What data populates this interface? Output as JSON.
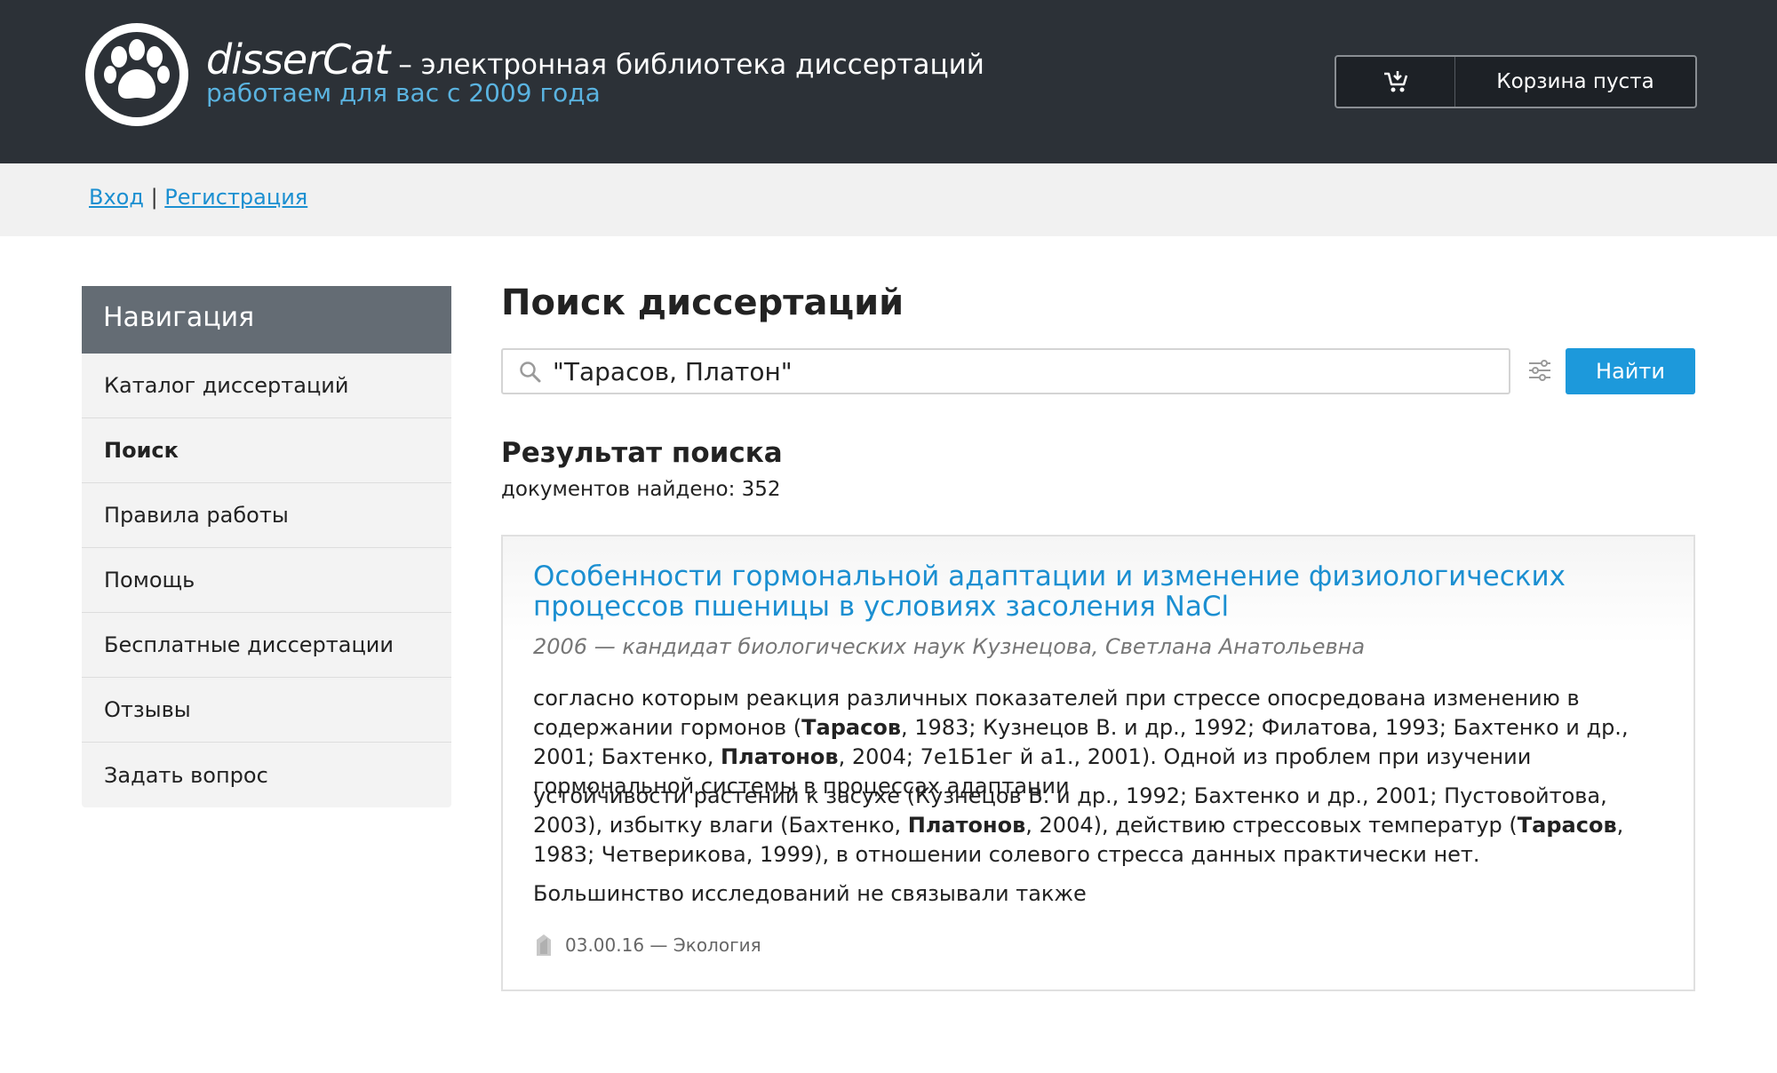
{
  "header": {
    "brand_name": "disserCat",
    "brand_tagline": " – электронная библиотека диссертаций",
    "brand_sub": "работаем для вас с 2009 года",
    "cart_label": "Корзина пуста",
    "logo_icon": "paw-icon",
    "cart_icon": "cart-icon"
  },
  "auth": {
    "login": "Вход",
    "separator": " | ",
    "register": "Регистрация"
  },
  "sidebar": {
    "title": "Навигация",
    "items": [
      {
        "label": "Каталог диссертаций",
        "active": false
      },
      {
        "label": "Поиск",
        "active": true
      },
      {
        "label": "Правила работы",
        "active": false
      },
      {
        "label": "Помощь",
        "active": false
      },
      {
        "label": "Бесплатные диссертации",
        "active": false
      },
      {
        "label": "Отзывы",
        "active": false
      },
      {
        "label": "Задать вопрос",
        "active": false
      }
    ]
  },
  "main": {
    "title": "Поиск диссертаций",
    "search_value": "\"Тарасов, Платон\"",
    "find_label": "Найти",
    "result_title": "Результат поиска",
    "result_count": "документов найдено: 352"
  },
  "result": {
    "title": "Особенности гормональной адаптации и изменение физиологических процессов пшеницы в условиях засоления NaCl",
    "meta": "2006 — кандидат биологических наук Кузнецова, Светлана Анатольевна",
    "snippets": [
      [
        {
          "t": "согласно которым реакция различных показателей при стрессе опосредована изменению в содержании гормонов ("
        },
        {
          "t": "Тарасов",
          "b": true
        },
        {
          "t": ", 1983; Кузнецов В. и др., 1992; Филатова, 1993; Бахтенко и др., 2001; Бахтенко, "
        },
        {
          "t": "Платонов",
          "b": true
        },
        {
          "t": ", 2004; 7е1Б1ег й а1., 2001). Одной из проблем при изучении гормональной системы в процессах адаптации"
        }
      ],
      [
        {
          "t": "устойчивости растений к засухе (Кузнецов В. и др., 1992; Бахтенко и др., 2001; Пустовойтова, 2003), избытку влаги (Бахтенко, "
        },
        {
          "t": "Платонов",
          "b": true
        },
        {
          "t": ", 2004), действию стрессовых температур ("
        },
        {
          "t": "Тарасов",
          "b": true
        },
        {
          "t": ", 1983; Четверикова, 1999), в отношении солевого стресса данных практически нет."
        }
      ],
      [
        {
          "t": "Большинство исследований не связывали также"
        }
      ]
    ],
    "footer": "03.00.16 — Экология",
    "colors": {
      "link": "#1b8fd1",
      "header_bg": "#2c3137",
      "button": "#1d99db"
    }
  }
}
